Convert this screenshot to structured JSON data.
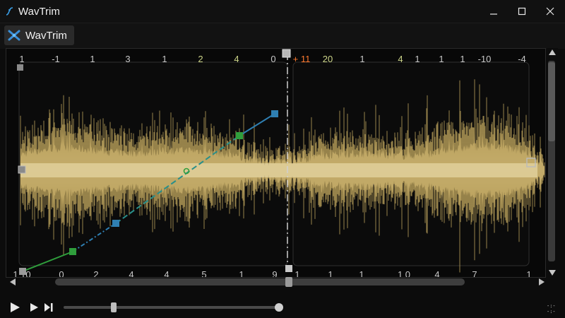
{
  "window": {
    "title": "WavTrim"
  },
  "toolbar": {
    "tab_label": "WavTrim"
  },
  "ruler": {
    "ticks": [
      {
        "label": "1",
        "color": "#c8c8c8"
      },
      {
        "label": "-1",
        "color": "#c8c8c8"
      },
      {
        "label": "1",
        "color": "#c8c8c8"
      },
      {
        "label": "3",
        "color": "#c8c8c8"
      },
      {
        "label": "1",
        "color": "#c8c8c8"
      },
      {
        "label": "2",
        "color": "#cdd58a"
      },
      {
        "label": "4",
        "color": "#cdd58a"
      },
      {
        "label": "0",
        "color": "#c8c8c8"
      },
      {
        "label": "+ 11",
        "color": "#ff7a2f"
      },
      {
        "label": "20",
        "color": "#cdd58a"
      },
      {
        "label": "1",
        "color": "#c8c8c8"
      },
      {
        "label": "4",
        "color": "#cdd58a"
      },
      {
        "label": "1",
        "color": "#c8c8c8"
      },
      {
        "label": "1",
        "color": "#c8c8c8"
      },
      {
        "label": "1",
        "color": "#c8c8c8"
      },
      {
        "label": "-10",
        "color": "#c8c8c8"
      },
      {
        "label": "-4",
        "color": "#c8c8c8"
      }
    ],
    "bottom_ticks": [
      {
        "label": "1 10",
        "color": "#c8c8c8"
      },
      {
        "label": "0",
        "color": "#c8c8c8"
      },
      {
        "label": "2",
        "color": "#c8c8c8"
      },
      {
        "label": "4",
        "color": "#c8c8c8"
      },
      {
        "label": "4",
        "color": "#c8c8c8"
      },
      {
        "label": "5",
        "color": "#c8c8c8"
      },
      {
        "label": "1",
        "color": "#c8c8c8"
      },
      {
        "label": "9",
        "color": "#c8c8c8"
      },
      {
        "label": "1",
        "color": "#c8c8c8"
      },
      {
        "label": "1",
        "color": "#c8c8c8"
      },
      {
        "label": "1",
        "color": "#c8c8c8"
      },
      {
        "label": "1 0",
        "color": "#c8c8c8"
      },
      {
        "label": "4",
        "color": "#c8c8c8"
      },
      {
        "label": "7",
        "color": "#c8c8c8"
      },
      {
        "label": "1",
        "color": "#c8c8c8"
      }
    ]
  },
  "colors": {
    "waveform": "#e7d39a",
    "waveform_edge": "#b89f5a",
    "envelope_green": "#2f9e3c",
    "envelope_blue": "#2f7fb2",
    "playhead": "#cfcfcf",
    "background": "#080808"
  },
  "transport": {
    "play_icon": "play-icon",
    "play_next_icon": "play-next-icon",
    "skip_end_icon": "skip-to-end-icon",
    "position_fraction": 0.2,
    "volume_fraction": 0.81
  },
  "scroll": {
    "horizontal_position_fraction": 0.58,
    "vertical_visible_fraction": 0.4
  }
}
